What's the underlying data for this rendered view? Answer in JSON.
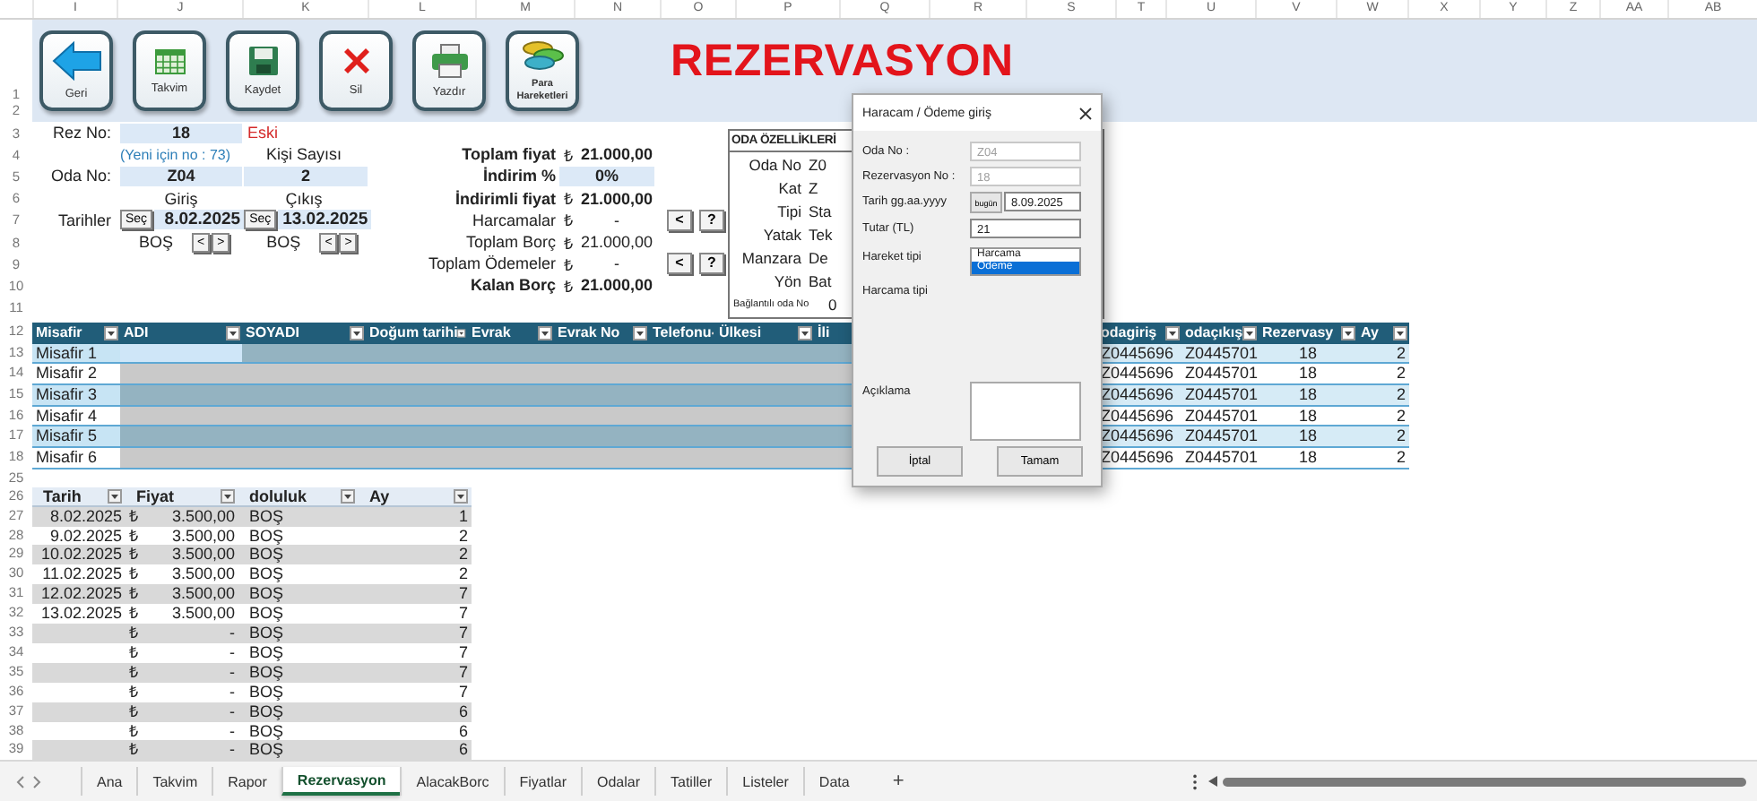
{
  "columns": [
    "I",
    "J",
    "K",
    "L",
    "M",
    "N",
    "O",
    "P",
    "Q",
    "R",
    "S",
    "T",
    "U",
    "V",
    "W",
    "X",
    "Y",
    "Z",
    "AA",
    "AB"
  ],
  "toolbar": {
    "rows": [
      "1",
      "2"
    ],
    "title": "REZERVASYON",
    "buttons": [
      {
        "label": "Geri",
        "kind": "back"
      },
      {
        "label": "Takvim",
        "kind": "calendar"
      },
      {
        "label": "Kaydet",
        "kind": "save"
      },
      {
        "label": "Sil",
        "kind": "delete"
      },
      {
        "label": "Yazdır",
        "kind": "print"
      },
      {
        "label": "Para Hareketleri",
        "kind": "money"
      }
    ]
  },
  "form": {
    "rows": [
      "3",
      "4",
      "5",
      "6",
      "7",
      "8",
      "9",
      "10",
      "11"
    ],
    "rez_label": "Rez No:",
    "rez_no": "18",
    "rez_status": "Eski",
    "new_hint": "(Yeni için no : 73)",
    "guests_label": "Kişi Sayısı",
    "room_label": "Oda No:",
    "room": "Z04",
    "guests": "2",
    "dates_label": "Tarihler",
    "checkin": {
      "label": "Giriş",
      "button": "Seç",
      "date": "8.02.2025",
      "status": "BOŞ",
      "prev": "<",
      "next": ">"
    },
    "checkout": {
      "label": "Çıkış",
      "button": "Seç",
      "date": "13.02.2025",
      "status": "BOŞ",
      "prev": "<",
      "next": ">"
    }
  },
  "totals": [
    {
      "label": "Toplam fiyat",
      "kind": "total",
      "currency": "₺",
      "value": "21.000,00"
    },
    {
      "label": "İndirim %",
      "kind": "input",
      "value": "0%"
    },
    {
      "label": "İndirimli fiyat",
      "kind": "total",
      "currency": "₺",
      "value": "21.000,00"
    },
    {
      "label": "Harcamalar",
      "kind": "amount",
      "currency": "₺",
      "value": "-",
      "buttons": [
        "<",
        "?"
      ]
    },
    {
      "label": "Toplam Borç",
      "kind": "amount",
      "currency": "₺",
      "value": "21.000,00"
    },
    {
      "label": "Toplam Ödemeler",
      "kind": "amount",
      "currency": "₺",
      "value": "-",
      "buttons": [
        "<",
        "?"
      ]
    },
    {
      "label": "Kalan Borç",
      "kind": "total",
      "currency": "₺",
      "value": "21.000,00"
    }
  ],
  "room_panel": {
    "title": "ODA ÖZELLİKLERİ",
    "rows": [
      {
        "label": "Oda No",
        "value": "Z0",
        "kind": "field"
      },
      {
        "label": "Kat",
        "value": "Z",
        "kind": "field"
      },
      {
        "label": "Tipi",
        "value": "Sta",
        "kind": "field"
      },
      {
        "label": "Yatak",
        "value": "Tek",
        "kind": "field"
      },
      {
        "label": "Manzara",
        "value": "De",
        "kind": "field"
      },
      {
        "label": "Yön",
        "value": "Bat",
        "kind": "field"
      },
      {
        "label": "Bağlantılı oda No",
        "value": "0",
        "kind": "compact"
      }
    ]
  },
  "guest_table": {
    "header_row": "12",
    "columns": [
      "Misafir",
      "ADI",
      "SOYADI",
      "Doğum tarihi",
      "Evrak",
      "Evrak No",
      "Telefonu",
      "Ülkesi",
      "İli",
      "odagiriş",
      "odaçıkış",
      "Rezervasy",
      "Ay"
    ],
    "rows": [
      {
        "row": "13",
        "guest": "Misafir 1",
        "selected": true,
        "check_in": "Z0445696",
        "check_out": "Z0445701",
        "reservation": "18",
        "month": "2"
      },
      {
        "row": "14",
        "guest": "Misafir 2",
        "selected": false,
        "check_in": "Z0445696",
        "check_out": "Z0445701",
        "reservation": "18",
        "month": "2"
      },
      {
        "row": "15",
        "guest": "Misafir 3",
        "selected": false,
        "check_in": "Z0445696",
        "check_out": "Z0445701",
        "reservation": "18",
        "month": "2"
      },
      {
        "row": "16",
        "guest": "Misafir 4",
        "selected": false,
        "check_in": "Z0445696",
        "check_out": "Z0445701",
        "reservation": "18",
        "month": "2"
      },
      {
        "row": "17",
        "guest": "Misafir 5",
        "selected": false,
        "check_in": "Z0445696",
        "check_out": "Z0445701",
        "reservation": "18",
        "month": "2"
      },
      {
        "row": "18",
        "guest": "Misafir 6",
        "selected": false,
        "check_in": "Z0445696",
        "check_out": "Z0445701",
        "reservation": "18",
        "month": "2"
      }
    ]
  },
  "gap_row": "25",
  "price_table": {
    "header_row": "26",
    "columns": [
      "Tarih",
      "Fiyat",
      "doluluk",
      "Ay"
    ],
    "rows": [
      {
        "row": "27",
        "date": "8.02.2025",
        "currency": "₺",
        "price": "3.500,00",
        "status": "BOŞ",
        "month": "1"
      },
      {
        "row": "28",
        "date": "9.02.2025",
        "currency": "₺",
        "price": "3.500,00",
        "status": "BOŞ",
        "month": "2"
      },
      {
        "row": "29",
        "date": "10.02.2025",
        "currency": "₺",
        "price": "3.500,00",
        "status": "BOŞ",
        "month": "2"
      },
      {
        "row": "30",
        "date": "11.02.2025",
        "currency": "₺",
        "price": "3.500,00",
        "status": "BOŞ",
        "month": "2"
      },
      {
        "row": "31",
        "date": "12.02.2025",
        "currency": "₺",
        "price": "3.500,00",
        "status": "BOŞ",
        "month": "7"
      },
      {
        "row": "32",
        "date": "13.02.2025",
        "currency": "₺",
        "price": "3.500,00",
        "status": "BOŞ",
        "month": "7"
      },
      {
        "row": "33",
        "currency": "₺",
        "price": "-",
        "status": "BOŞ",
        "month": "7"
      },
      {
        "row": "34",
        "currency": "₺",
        "price": "-",
        "status": "BOŞ",
        "month": "7"
      },
      {
        "row": "35",
        "currency": "₺",
        "price": "-",
        "status": "BOŞ",
        "month": "7"
      },
      {
        "row": "36",
        "currency": "₺",
        "price": "-",
        "status": "BOŞ",
        "month": "7"
      },
      {
        "row": "37",
        "currency": "₺",
        "price": "-",
        "status": "BOŞ",
        "month": "6"
      },
      {
        "row": "38",
        "currency": "₺",
        "price": "-",
        "status": "BOŞ",
        "month": "6"
      },
      {
        "row": "39",
        "currency": "₺",
        "price": "-",
        "status": "BOŞ",
        "month": "6"
      }
    ]
  },
  "dialog": {
    "title": "Haracam / Ödeme giriş",
    "fields": [
      {
        "label": "Oda No :",
        "kind": "text",
        "value": "Z04",
        "disabled": true
      },
      {
        "label": "Rezervasyon  No :",
        "kind": "text",
        "value": "18",
        "disabled": true
      },
      {
        "label": "Tarih gg.aa.yyyy",
        "kind": "date",
        "button": "bugün",
        "value": "8.09.2025",
        "disabled": false
      },
      {
        "label": "Tutar (TL)",
        "kind": "text",
        "value": "21",
        "disabled": false
      },
      {
        "label": "Hareket tipi",
        "kind": "list",
        "options": [
          {
            "label": "Harcama",
            "selected": false
          },
          {
            "label": "Ödeme",
            "selected": true
          }
        ]
      },
      {
        "label": "Harcama tipi",
        "kind": "label"
      },
      {
        "label": "Açıklama",
        "kind": "textarea"
      }
    ],
    "buttons": [
      "İptal",
      "Tamam"
    ]
  },
  "sheet_tabs": {
    "tabs": [
      {
        "label": "Ana",
        "selected": false
      },
      {
        "label": "Takvim",
        "selected": false
      },
      {
        "label": "Rapor",
        "selected": false
      },
      {
        "label": "Rezervasyon",
        "selected": true
      },
      {
        "label": "AlacakBorc",
        "selected": false
      },
      {
        "label": "Fiyatlar",
        "selected": false
      },
      {
        "label": "Odalar",
        "selected": false
      },
      {
        "label": "Tatiller",
        "selected": false
      },
      {
        "label": "Listeler",
        "selected": false
      },
      {
        "label": "Data",
        "selected": false
      }
    ],
    "add": "+"
  }
}
